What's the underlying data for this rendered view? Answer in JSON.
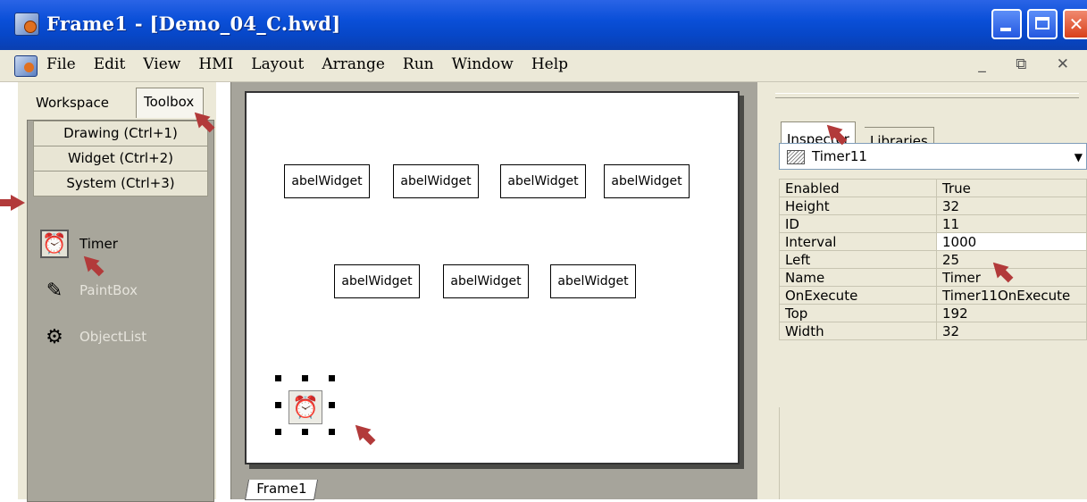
{
  "window": {
    "title": "Frame1 - [Demo_04_C.hwd]"
  },
  "menubar": {
    "items": [
      "File",
      "Edit",
      "View",
      "HMI",
      "Layout",
      "Arrange",
      "Run",
      "Window",
      "Help"
    ]
  },
  "left_panel": {
    "tabs": [
      "Workspace",
      "Toolbox"
    ],
    "active_tab": "Toolbox",
    "categories": [
      "Drawing (Ctrl+1)",
      "Widget (Ctrl+2)",
      "System (Ctrl+3)"
    ],
    "tools": [
      {
        "label": "Timer",
        "icon": "timer-icon",
        "selected": true
      },
      {
        "label": "PaintBox",
        "icon": "paintbox-icon",
        "selected": false
      },
      {
        "label": "ObjectList",
        "icon": "objectlist-icon",
        "selected": false
      }
    ]
  },
  "design": {
    "labels_row1": [
      "abelWidget",
      "abelWidget",
      "abelWidget",
      "abelWidget"
    ],
    "labels_row2": [
      "abelWidget",
      "abelWidget",
      "abelWidget"
    ],
    "frame_tab": "Frame1"
  },
  "right_panel": {
    "tabs": [
      "Inspector",
      "Libraries"
    ],
    "active_tab": "Inspector",
    "selected_object": "Timer11",
    "properties": [
      {
        "name": "Enabled",
        "value": "True"
      },
      {
        "name": "Height",
        "value": "32"
      },
      {
        "name": "ID",
        "value": "11"
      },
      {
        "name": "Interval",
        "value": "1000"
      },
      {
        "name": "Left",
        "value": "25"
      },
      {
        "name": "Name",
        "value": "Timer"
      },
      {
        "name": "OnExecute",
        "value": "Timer11OnExecute"
      },
      {
        "name": "Top",
        "value": "192"
      },
      {
        "name": "Width",
        "value": "32"
      }
    ]
  },
  "colors": {
    "titlebar": "#0a4fd8",
    "panel": "#ece9d8",
    "annotation_arrow": "#b23a3a"
  }
}
